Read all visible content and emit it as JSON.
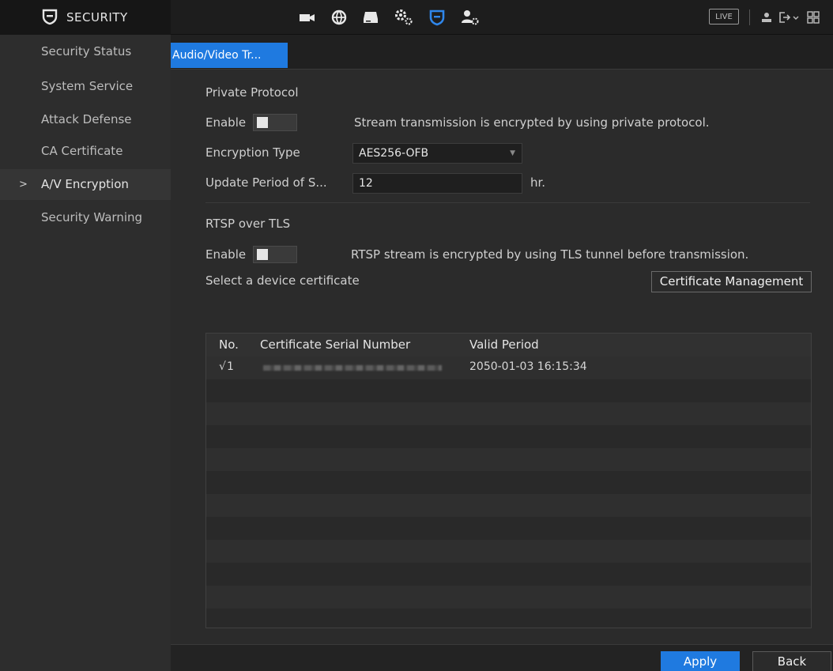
{
  "header": {
    "title": "SECURITY",
    "live_label": "LIVE",
    "nav_icons": [
      "camera-icon",
      "network-icon",
      "storage-icon",
      "system-settings-icon",
      "security-shield-icon",
      "account-icon"
    ],
    "active_nav": "security-shield-icon",
    "accent_color": "#1f7ae0"
  },
  "sidebar": {
    "items": [
      {
        "label": "Security Status"
      },
      {
        "label": "System Service"
      },
      {
        "label": "Attack Defense"
      },
      {
        "label": "CA Certificate"
      },
      {
        "label": "A/V Encryption",
        "active": true,
        "chevron": ">"
      },
      {
        "label": "Security Warning"
      }
    ]
  },
  "tabs": [
    {
      "label": "Audio/Video Tr...",
      "active": true
    }
  ],
  "private_protocol": {
    "heading": "Private Protocol",
    "enable_label": "Enable",
    "enable_on": false,
    "enable_desc": "Stream transmission is encrypted by using private protocol.",
    "encryption_type_label": "Encryption Type",
    "encryption_type_value": "AES256-OFB",
    "update_period_label": "Update Period of S...",
    "update_period_value": "12",
    "update_period_unit": "hr."
  },
  "rtsp": {
    "heading": "RTSP over TLS",
    "enable_label": "Enable",
    "enable_on": false,
    "enable_desc": "RTSP stream is encrypted by using TLS tunnel before transmission.",
    "select_cert_label": "Select a device certificate",
    "cert_mgmt_button": "Certificate Management"
  },
  "cert_table": {
    "columns": [
      "No.",
      "Certificate Serial Number",
      "Valid Period"
    ],
    "rows": [
      {
        "check": "√",
        "no": "1",
        "valid_period": "2050-01-03 16:15:34"
      }
    ]
  },
  "footer": {
    "apply_label": "Apply",
    "back_label": "Back"
  }
}
